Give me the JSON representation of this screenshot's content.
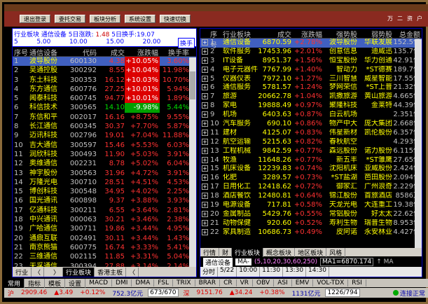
{
  "toolbar": {
    "buttons": [
      "退出登录",
      "委托交易",
      "板块分析",
      "系统设置",
      "快速切换"
    ],
    "right": [
      "万",
      "二",
      "资",
      "户"
    ]
  },
  "left_panel": {
    "header_line": "行业板块  通信设备  5日涨跌:",
    "header_value": "1.48",
    "header_suffix": "5日换手:19.07",
    "ruler": [
      "5.00",
      "10.00",
      "15.00",
      "20.00"
    ],
    "ruler_unit": "5",
    "hand_button": "换手",
    "columns": [
      "序号",
      "通信设备",
      "代码",
      "成交",
      "涨跌幅",
      "换手率"
    ],
    "rows": [
      {
        "n": "1",
        "name": "波导股份",
        "code": "600130",
        "price": "4.38",
        "chg": "+10.05%",
        "turn": "3.60%",
        "pill": "up"
      },
      {
        "n": "2",
        "name": "吴通控股",
        "code": "300292",
        "price": "8.55",
        "chg": "+10.04%",
        "turn": "11.98%",
        "pill": "up"
      },
      {
        "n": "3",
        "name": "东土科技",
        "code": "300353",
        "price": "16.12",
        "chg": "+10.03%",
        "turn": "10.70%",
        "pill": "up"
      },
      {
        "n": "4",
        "name": "东方通信",
        "code": "600776",
        "price": "27.25",
        "chg": "+10.01%",
        "turn": "5.94%",
        "pill": "up"
      },
      {
        "n": "5",
        "name": "闻泰科技",
        "code": "600745",
        "price": "94.77",
        "chg": "+10.01%",
        "turn": "1.89%",
        "pill": "up"
      },
      {
        "n": "6",
        "name": "科信技术",
        "code": "300565",
        "price": "14.10",
        "chg": "-9.98%",
        "turn": "5.44%",
        "pill": "dn"
      },
      {
        "n": "7",
        "name": "东信和平",
        "code": "002017",
        "price": "16.16",
        "chg": "+8.75%",
        "turn": "9.55%",
        "pill": ""
      },
      {
        "n": "8",
        "name": "长江通信",
        "code": "600345",
        "price": "30.37",
        "chg": "+7.70%",
        "turn": "5.87%",
        "pill": ""
      },
      {
        "n": "9",
        "name": "迈讯科技",
        "code": "002796",
        "price": "19.01",
        "chg": "+7.04%",
        "turn": "11.88%",
        "pill": ""
      },
      {
        "n": "10",
        "name": "吉大通信",
        "code": "300597",
        "price": "15.46",
        "chg": "+5.53%",
        "turn": "6.03%",
        "pill": ""
      },
      {
        "n": "11",
        "name": "润欣科技",
        "code": "300493",
        "price": "11.90",
        "chg": "+5.03%",
        "turn": "3.91%",
        "pill": ""
      },
      {
        "n": "12",
        "name": "奥维通信",
        "code": "002231",
        "price": "8.78",
        "chg": "+5.02%",
        "turn": "6.04%",
        "pill": ""
      },
      {
        "n": "13",
        "name": "神宇股份",
        "code": "300563",
        "price": "31.96",
        "chg": "+4.72%",
        "turn": "3.91%",
        "pill": ""
      },
      {
        "n": "14",
        "name": "万隆光电",
        "code": "300710",
        "price": "28.51",
        "chg": "+4.51%",
        "turn": "4.53%",
        "pill": ""
      },
      {
        "n": "15",
        "name": "博创科技",
        "code": "300548",
        "price": "34.95",
        "chg": "+4.02%",
        "turn": "2.25%",
        "pill": ""
      },
      {
        "n": "16",
        "name": "国光通讯",
        "code": "600898",
        "price": "9.37",
        "chg": "+3.88%",
        "turn": "3.93%",
        "pill": ""
      },
      {
        "n": "17",
        "name": "亿通科技",
        "code": "300211",
        "price": "6.55",
        "chg": "+3.64%",
        "turn": "2.81%",
        "pill": ""
      },
      {
        "n": "18",
        "name": "中兴通讯",
        "code": "000063",
        "price": "30.21",
        "chg": "+3.46%",
        "turn": "2.38%",
        "pill": ""
      },
      {
        "n": "19",
        "name": "广哈通信",
        "code": "300711",
        "price": "19.86",
        "chg": "+3.44%",
        "turn": "4.95%",
        "pill": ""
      },
      {
        "n": "20",
        "name": "通鼎互联",
        "code": "002491",
        "price": "30.11",
        "chg": "+3.44%",
        "turn": "1.43%",
        "pill": ""
      },
      {
        "n": "21",
        "name": "南京熊猫",
        "code": "600775",
        "price": "16.74",
        "chg": "+3.33%",
        "turn": "5.41%",
        "pill": ""
      },
      {
        "n": "22",
        "name": "三维通信",
        "code": "002115",
        "price": "11.85",
        "chg": "+3.31%",
        "turn": "5.04%",
        "pill": ""
      },
      {
        "n": "23",
        "name": "天孚通信",
        "code": "300394",
        "price": "27.88",
        "chg": "+3.14%",
        "turn": "2.14%",
        "pill": ""
      }
    ],
    "tabs": [
      "行业",
      "〈",
      "",
      "〉",
      "行业板块",
      "香港主板",
      "〈"
    ]
  },
  "right_panel": {
    "columns": [
      "序号",
      "行业板块",
      "成交",
      "涨跌幅",
      "强势股",
      "弱势股",
      "总金额"
    ],
    "rows": [
      {
        "n": "1",
        "name": "通信设备",
        "price": "6870.59",
        "chg": "+2.78%",
        "strong": "波导股份",
        "weak": "华联发展",
        "amt": "152.5亿"
      },
      {
        "n": "2",
        "name": "软件服务",
        "price": "17453.96",
        "chg": "+2.01%",
        "strong": "创意信息",
        "weak": "迪威迅",
        "amt": "135.7亿"
      },
      {
        "n": "3",
        "name": "IT设备",
        "price": "8951.37",
        "chg": "+1.56%",
        "strong": "恒宝股份",
        "weak": "华力创通",
        "amt": "42.91亿"
      },
      {
        "n": "4",
        "name": "电子元器件",
        "price": "7767.99",
        "chg": "+1.40%",
        "strong": "智动力",
        "weak": "*ST德赛",
        "amt": "189.7亿"
      },
      {
        "n": "5",
        "name": "仪器仪表",
        "price": "7972.10",
        "chg": "+1.27%",
        "strong": "三川智慧",
        "weak": "威星智能",
        "amt": "17.55亿"
      },
      {
        "n": "6",
        "name": "通信服务",
        "price": "5781.57",
        "chg": "+1.24%",
        "strong": "梦网荣信",
        "weak": "*ST上普",
        "amt": "21.32亿"
      },
      {
        "n": "7",
        "name": "旅游",
        "price": "20662.78",
        "chg": "+1.04%",
        "strong": "凯撒旅游",
        "weak": "黄山旅游",
        "amt": "4.665亿"
      },
      {
        "n": "8",
        "name": "家电",
        "price": "19888.49",
        "chg": "+0.97%",
        "strong": "聚隆科技",
        "weak": "金莱特",
        "amt": "44.39亿"
      },
      {
        "n": "9",
        "name": "机场",
        "price": "6403.63",
        "chg": "+0.87%",
        "strong": "白云机场",
        "weak": "",
        "amt": "2.351亿"
      },
      {
        "n": "10",
        "name": "汽车服务",
        "price": "690.10",
        "chg": "+0.86%",
        "strong": "物产中大",
        "weak": "庞大集团",
        "amt": "2.668亿"
      },
      {
        "n": "11",
        "name": "建材",
        "price": "4125.07",
        "chg": "+0.83%",
        "strong": "伟星新材",
        "weak": "凯伦股份",
        "amt": "6.357亿"
      },
      {
        "n": "12",
        "name": "航空运输",
        "price": "5215.63",
        "chg": "+0.82%",
        "strong": "春秋航空",
        "weak": "",
        "amt": "4.293亿"
      },
      {
        "n": "13",
        "name": "工程机械",
        "price": "9842.59",
        "chg": "+0.77%",
        "strong": "森远股份",
        "weak": "诺力股份",
        "amt": "6.115亿"
      },
      {
        "n": "14",
        "name": "牧渔",
        "price": "11648.26",
        "chg": "+0.77%",
        "strong": "新五丰",
        "weak": "*ST雏鹰",
        "amt": "27.65亿"
      },
      {
        "n": "15",
        "name": "机床设备",
        "price": "12239.83",
        "chg": "+0.74%",
        "strong": "沈阳机床",
        "weak": "亚威股份",
        "amt": "2.424亿"
      },
      {
        "n": "16",
        "name": "化肥",
        "price": "3289.57",
        "chg": "+0.73%",
        "strong": "*ST盐湖",
        "weak": "芭田股份",
        "amt": "2.094亿"
      },
      {
        "n": "17",
        "name": "日用化工",
        "price": "12418.62",
        "chg": "+0.72%",
        "strong": "御家汇",
        "weak": "广州浪奇",
        "amt": "2.229亿"
      },
      {
        "n": "18",
        "name": "酒店餐饮",
        "price": "12480.81",
        "chg": "+0.64%",
        "strong": "锦江股份",
        "weak": "首旅酒店",
        "amt": "8586万"
      },
      {
        "n": "19",
        "name": "电源设备",
        "price": "717.81",
        "chg": "+0.58%",
        "strong": "天龙光电",
        "weak": "大连重工",
        "amt": "19.38亿"
      },
      {
        "n": "20",
        "name": "金属制品",
        "price": "5429.76",
        "chg": "+0.55%",
        "strong": "常铝股份",
        "weak": "好太太",
        "amt": "22.62亿"
      },
      {
        "n": "21",
        "name": "动物保健",
        "price": "920.60",
        "chg": "+0.52%",
        "strong": "寿利生物",
        "weak": "瑞普生物",
        "amt": "8.953亿"
      },
      {
        "n": "22",
        "name": "家具制造",
        "price": "10686.73",
        "chg": "+0.49%",
        "strong": "皮阿诺",
        "weak": "永安林业",
        "amt": "4.427亿"
      }
    ],
    "tabs": [
      "行情",
      "财",
      "行业板块",
      "概念板块",
      "地区板块",
      "风格"
    ],
    "ma_label": "通信设备",
    "ma_box": "MA-",
    "ma_params": "(5,10,20,30,60,250)",
    "ma1": "MA1=6870.174",
    "ma_right": "↑ MA",
    "timeline": [
      "分时",
      "5/22",
      "10:00",
      "11:30",
      "13:30",
      "14:30"
    ]
  },
  "status_tabs": [
    "常用",
    "指标",
    "模板",
    "设置",
    "MACD",
    "DMI",
    "DMA",
    "FSL",
    "TRIX",
    "BRAR",
    "CR",
    "VR",
    "OBV",
    "ASI",
    "EMV",
    "VOL-TDX",
    "RSI"
  ],
  "status_bar": {
    "i1_name": "沪",
    "i1_val": "2909.46",
    "i1_chg": "▲3.49",
    "i1_pct": "+0.12%",
    "i1_amt": "752.3亿元",
    "i1_adv": "673/670",
    "i2_name": "深",
    "i2_val": "9151.76",
    "i2_chg": "▲34.24",
    "i2_pct": "+0.38%",
    "i2_amt": "1131亿元",
    "i2_adv": "1226/794",
    "broker": "连接正常"
  },
  "colors": {
    "up": "#ff3232",
    "down": "#00e000",
    "accent": "#ffff00",
    "select": "#4060c0"
  }
}
